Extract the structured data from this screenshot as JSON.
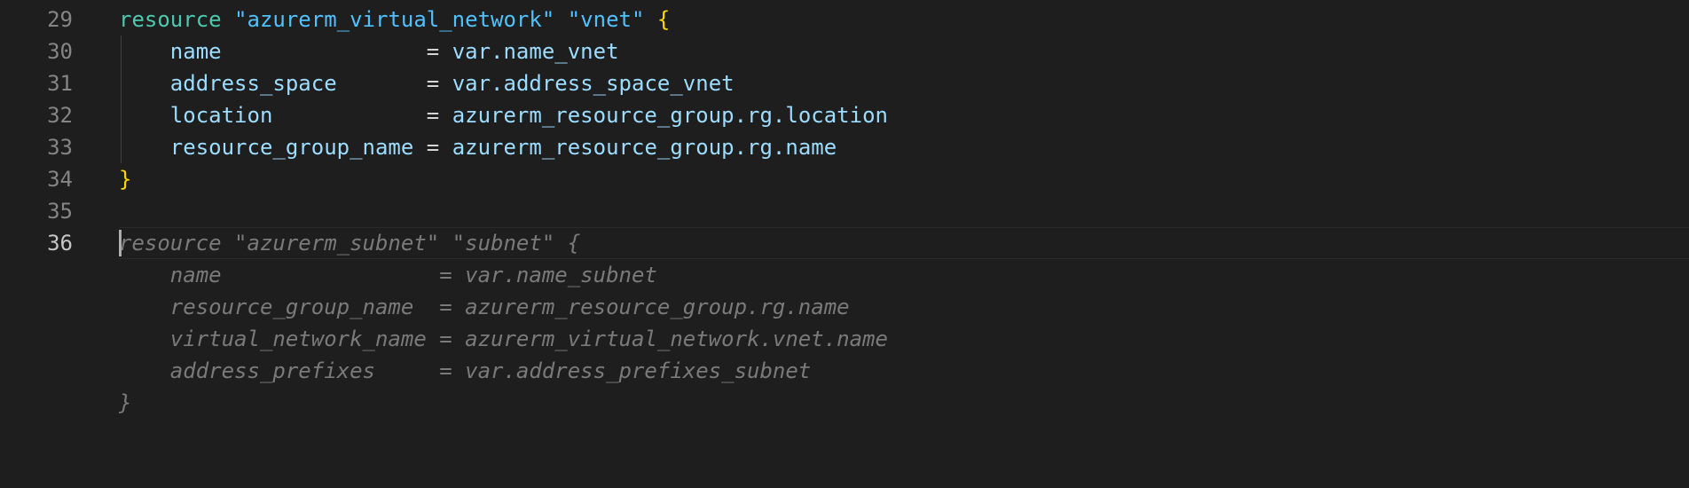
{
  "editor": {
    "line_numbers": [
      "29",
      "30",
      "31",
      "32",
      "33",
      "34",
      "35",
      "36"
    ],
    "active_line": "36",
    "colors": {
      "background": "#1e1e1e",
      "keyword": "#4ec9b0",
      "string": "#4fc1ff",
      "property": "#9cdcfe",
      "brace": "#ffd700",
      "ghost_suggestion": "#7a7a7a"
    },
    "vnet_block": {
      "keyword": "resource",
      "type": "\"azurerm_virtual_network\"",
      "name": "\"vnet\"",
      "open_brace": "{",
      "attributes": [
        {
          "key": "name",
          "pad": "                ",
          "value": "var.name_vnet"
        },
        {
          "key": "address_space",
          "pad": "       ",
          "value": "var.address_space_vnet"
        },
        {
          "key": "location",
          "pad": "            ",
          "value": "azurerm_resource_group.rg.location"
        },
        {
          "key": "resource_group_name",
          "pad": " ",
          "value": "azurerm_resource_group.rg.name"
        }
      ],
      "close_brace": "}"
    },
    "subnet_suggestion": {
      "lines": [
        "resource \"azurerm_subnet\" \"subnet\" {",
        "    name                 = var.name_subnet",
        "    resource_group_name  = azurerm_resource_group.rg.name",
        "    virtual_network_name = azurerm_virtual_network.vnet.name",
        "    address_prefixes     = var.address_prefixes_subnet",
        "}"
      ]
    }
  }
}
